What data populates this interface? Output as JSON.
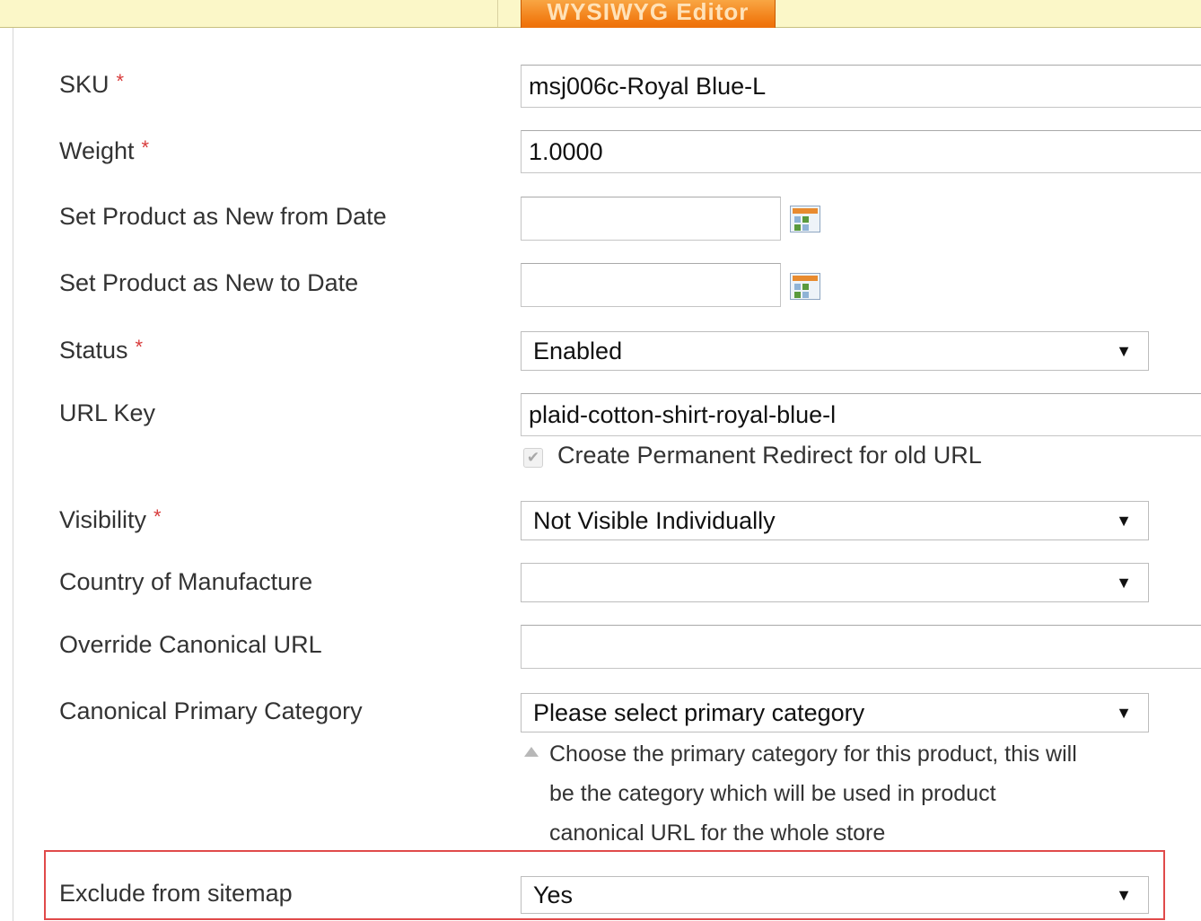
{
  "toolbar": {
    "wysiwyg_button_label": "WYSIWYG Editor"
  },
  "form": {
    "sku": {
      "label": "SKU",
      "required_mark": "*",
      "value": "msj006c-Royal Blue-L"
    },
    "weight": {
      "label": "Weight",
      "required_mark": "*",
      "value": "1.0000"
    },
    "new_from_date": {
      "label": "Set Product as New from Date",
      "value": ""
    },
    "new_to_date": {
      "label": "Set Product as New to Date",
      "value": ""
    },
    "status": {
      "label": "Status",
      "required_mark": "*",
      "selected": "Enabled"
    },
    "url_key": {
      "label": "URL Key",
      "value": "plaid-cotton-shirt-royal-blue-l",
      "redirect_checkbox_label": "Create Permanent Redirect for old URL",
      "redirect_checked": true
    },
    "visibility": {
      "label": "Visibility",
      "required_mark": "*",
      "selected": "Not Visible Individually"
    },
    "country_of_manufacture": {
      "label": "Country of Manufacture",
      "selected": ""
    },
    "override_canonical_url": {
      "label": "Override Canonical URL",
      "value": ""
    },
    "canonical_primary_category": {
      "label": "Canonical Primary Category",
      "selected": "Please select primary category",
      "help_line1": "Choose the primary category for this product, this will",
      "help_line2": "be the category which will be used in product",
      "help_line3": "canonical URL for the whole store"
    },
    "exclude_from_sitemap": {
      "label": "Exclude from sitemap",
      "selected": "Yes"
    }
  },
  "icons": {
    "select_arrow": "▼",
    "checkmark": "✔"
  },
  "colors": {
    "required": "#d83b3b",
    "highlight_border": "#e04a4a",
    "button_orange": "#f0750c"
  }
}
